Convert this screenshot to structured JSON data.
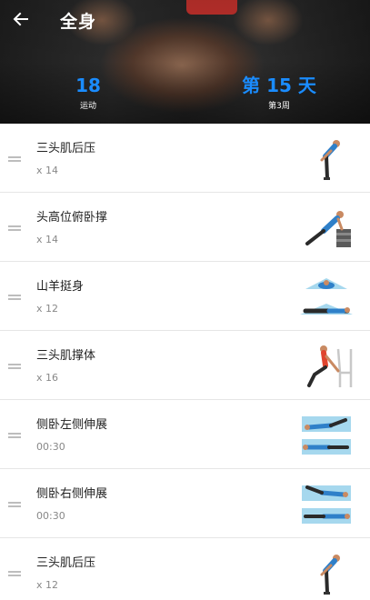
{
  "header": {
    "title": "全身",
    "back_icon": "arrow-left-icon",
    "stats": {
      "exercises_value": "18",
      "exercises_label": "运动",
      "day_value": "第 15 天",
      "day_label": "第3周"
    }
  },
  "colors": {
    "accent": "#1a8cff",
    "swimwear_blue": "#2f80c9",
    "mat": "#a6d8ee"
  },
  "exercises": [
    {
      "name": "三头肌后压",
      "count": "x 14",
      "icon": "standing-bend-figure-icon"
    },
    {
      "name": "头高位俯卧撑",
      "count": "x 14",
      "icon": "incline-pushup-figure-icon"
    },
    {
      "name": "山羊挺身",
      "count": "x 12",
      "icon": "superman-figure-icon"
    },
    {
      "name": "三头肌撑体",
      "count": "x 16",
      "icon": "chair-dip-figure-icon"
    },
    {
      "name": "侧卧左侧伸展",
      "count": "00:30",
      "icon": "side-stretch-figure-icon"
    },
    {
      "name": "侧卧右侧伸展",
      "count": "00:30",
      "icon": "side-stretch-figure-icon"
    },
    {
      "name": "三头肌后压",
      "count": "x 12",
      "icon": "standing-bend-figure-icon"
    }
  ]
}
